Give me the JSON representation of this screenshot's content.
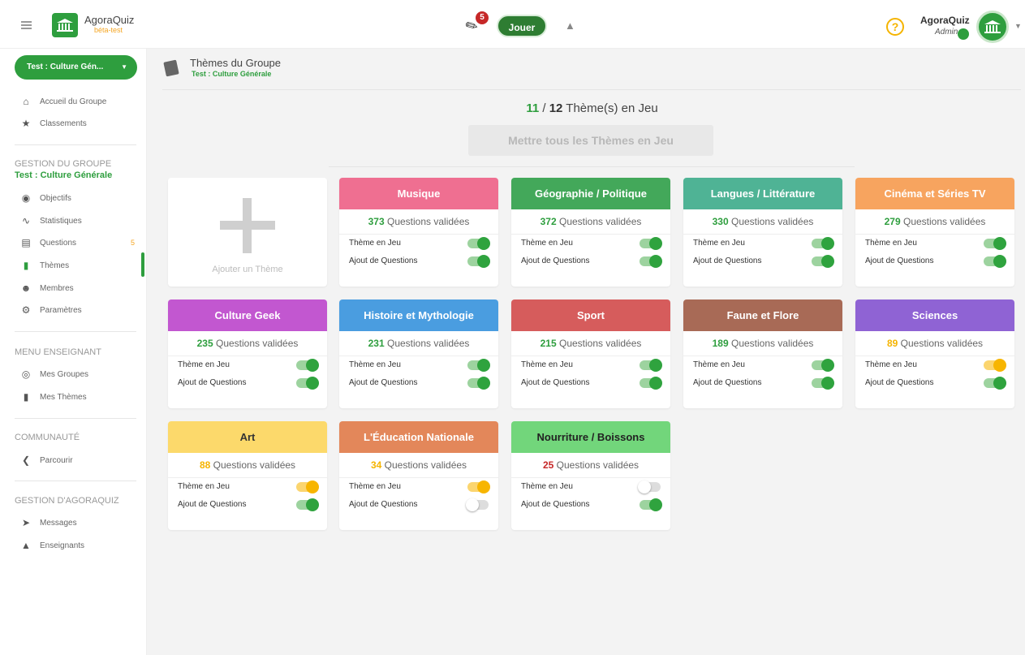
{
  "app": {
    "name": "AgoraQuiz",
    "badge": "béta-test",
    "notifications": "5",
    "play_label": "Jouer",
    "user_name": "AgoraQuiz",
    "user_role": "Admin",
    "help_glyph": "?"
  },
  "sidebar": {
    "group": "Test : Culture Gén...",
    "top_items": [
      {
        "label": "Accueil du Groupe",
        "icon": "home-icon"
      },
      {
        "label": "Classements",
        "icon": "star-icon"
      }
    ],
    "group_section": {
      "title": "GESTION DU GROUPE",
      "subtitle": "Test : Culture Générale"
    },
    "group_items": [
      {
        "label": "Objectifs",
        "icon": "target-icon"
      },
      {
        "label": "Statistiques",
        "icon": "chart-icon"
      },
      {
        "label": "Questions",
        "icon": "list-icon",
        "count": "5"
      },
      {
        "label": "Thèmes",
        "icon": "cards-icon"
      },
      {
        "label": "Membres",
        "icon": "people-icon"
      },
      {
        "label": "Paramètres",
        "icon": "gear-icon"
      }
    ],
    "teacher_section": {
      "title": "MENU ENSEIGNANT"
    },
    "teacher_items": [
      {
        "label": "Mes Groupes",
        "icon": "groups-icon"
      },
      {
        "label": "Mes Thèmes",
        "icon": "cards-icon"
      }
    ],
    "community_section": {
      "title": "COMMUNAUTÉ"
    },
    "community_items": [
      {
        "label": "Parcourir",
        "icon": "share-icon"
      }
    ],
    "admin_section": {
      "title": "GESTION D'AGORAQUIZ"
    },
    "admin_items": [
      {
        "label": "Messages",
        "icon": "send-icon"
      },
      {
        "label": "Enseignants",
        "icon": "graduation-icon"
      }
    ]
  },
  "header": {
    "title": "Thèmes du Groupe",
    "subtitle": "Test : Culture Générale"
  },
  "summary": {
    "active": "11",
    "separator": "/",
    "total": "12",
    "label": "Thème(s) en Jeu",
    "all_button": "Mettre tous les Thèmes en Jeu"
  },
  "add_theme": {
    "label": "Ajouter un Thème"
  },
  "labels": {
    "questions": "Questions validées",
    "in_play": "Thème en Jeu",
    "add_questions": "Ajout de Questions"
  },
  "colors": {
    "primary": "#2e9e3e",
    "count_green": "#2e9e3e",
    "count_orange": "#f5b400",
    "count_red": "#c62828"
  },
  "themes": [
    {
      "name": "Musique",
      "color": "#ef6f91",
      "count": "373",
      "count_color": "#2e9e3e",
      "in_play": "on",
      "add": "on"
    },
    {
      "name": "Géographie / Politique",
      "color": "#43a85a",
      "count": "372",
      "count_color": "#2e9e3e",
      "in_play": "on",
      "add": "on"
    },
    {
      "name": "Langues / Littérature",
      "color": "#4fb395",
      "count": "330",
      "count_color": "#2e9e3e",
      "in_play": "on",
      "add": "on"
    },
    {
      "name": "Cinéma et Séries TV",
      "color": "#f7a45f",
      "count": "279",
      "count_color": "#2e9e3e",
      "in_play": "on",
      "add": "on"
    },
    {
      "name": "Culture Geek",
      "color": "#c257d0",
      "count": "235",
      "count_color": "#2e9e3e",
      "in_play": "on",
      "add": "on"
    },
    {
      "name": "Histoire et Mythologie",
      "color": "#4a9de0",
      "count": "231",
      "count_color": "#2e9e3e",
      "in_play": "on",
      "add": "on"
    },
    {
      "name": "Sport",
      "color": "#d65c5c",
      "count": "215",
      "count_color": "#2e9e3e",
      "in_play": "on",
      "add": "on"
    },
    {
      "name": "Faune et Flore",
      "color": "#a86a56",
      "count": "189",
      "count_color": "#2e9e3e",
      "in_play": "on",
      "add": "on"
    },
    {
      "name": "Sciences",
      "color": "#8f63d4",
      "count": "89",
      "count_color": "#f5b400",
      "in_play": "pending",
      "add": "on"
    },
    {
      "name": "Art",
      "color": "#fcd96b",
      "text_color": "#333",
      "count": "88",
      "count_color": "#f5b400",
      "in_play": "pending",
      "add": "on"
    },
    {
      "name": "L'Éducation Nationale",
      "color": "#e3875a",
      "count": "34",
      "count_color": "#f5b400",
      "in_play": "pending",
      "add": "off"
    },
    {
      "name": "Nourriture / Boissons",
      "color": "#72d67b",
      "text_color": "#222",
      "count": "25",
      "count_color": "#c62828",
      "in_play": "off",
      "add": "on"
    }
  ]
}
